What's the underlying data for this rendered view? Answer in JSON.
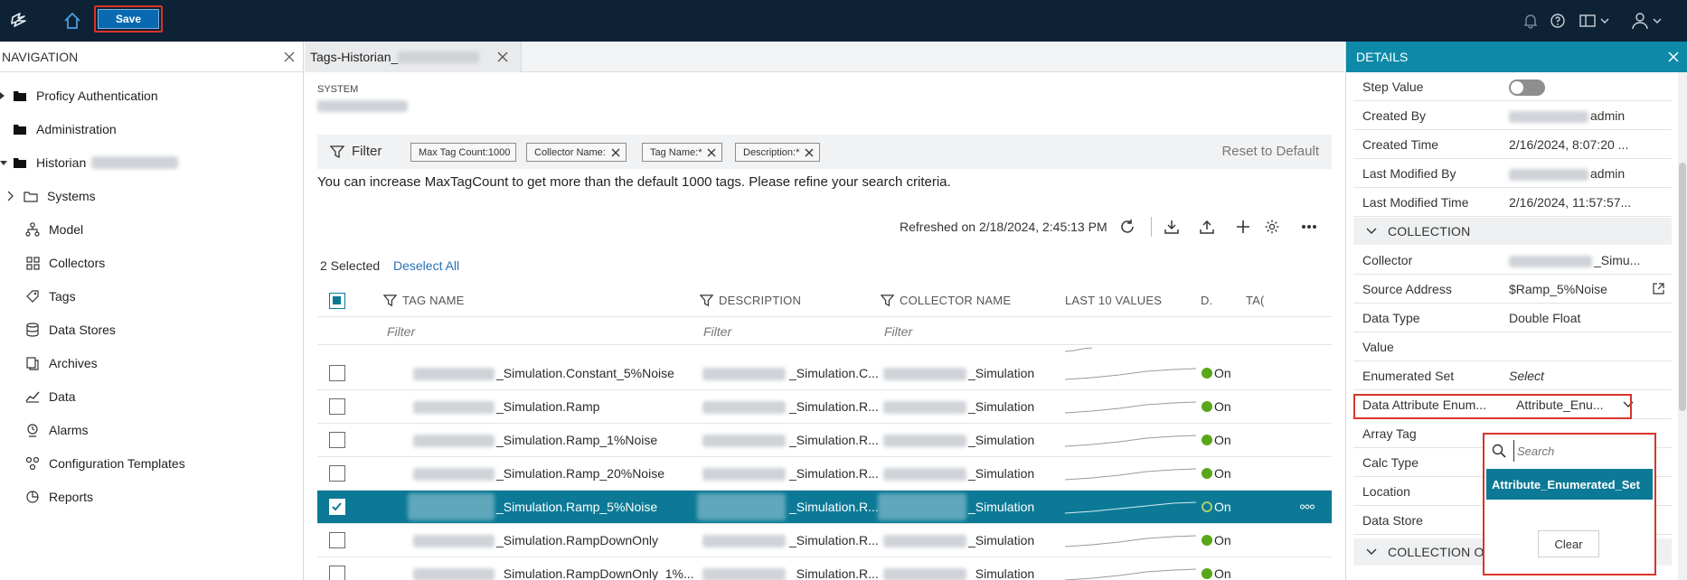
{
  "topbar": {
    "save_label": "Save"
  },
  "nav": {
    "title": "NAVIGATION",
    "items": [
      {
        "label": "Proficy Authentication",
        "icon": "folder-icon"
      },
      {
        "label": "Administration",
        "icon": "folder-icon"
      },
      {
        "label": "Historian",
        "icon": "folder-icon"
      },
      {
        "label": "Systems",
        "icon": "folder-outline-icon"
      },
      {
        "label": "Model",
        "icon": "hierarchy-icon"
      },
      {
        "label": "Collectors",
        "icon": "grid-icon"
      },
      {
        "label": "Tags",
        "icon": "tag-icon"
      },
      {
        "label": "Data Stores",
        "icon": "database-icon"
      },
      {
        "label": "Archives",
        "icon": "archive-icon"
      },
      {
        "label": "Data",
        "icon": "trend-icon"
      },
      {
        "label": "Alarms",
        "icon": "alarm-icon"
      },
      {
        "label": "Configuration Templates",
        "icon": "template-icon"
      },
      {
        "label": "Reports",
        "icon": "report-icon"
      }
    ]
  },
  "tab": {
    "label": "Tags-Historian_"
  },
  "main": {
    "system_label": "SYSTEM",
    "filter_label": "Filter",
    "chips": [
      "Max Tag Count:1000",
      "Collector Name:",
      "Tag Name:*",
      "Description:*"
    ],
    "reset_label": "Reset to Default",
    "info": "You can increase MaxTagCount to get more than the default 1000 tags. Please refine your search criteria.",
    "refreshed": "Refreshed on 2/18/2024, 2:45:13 PM",
    "selected_count": "2 Selected",
    "deselect_label": "Deselect All",
    "columns": [
      "TAG NAME",
      "DESCRIPTION",
      "COLLECTOR NAME",
      "LAST 10 VALUES",
      "D.",
      "TA("
    ],
    "filter_placeholder": "Filter",
    "rows": [
      {
        "tag": "_Simulation.Constant_5%Noise",
        "desc": "_Simulation.C...",
        "collector": "_Simulation",
        "status": "On",
        "selected": false
      },
      {
        "tag": "_Simulation.Ramp",
        "desc": "_Simulation.R...",
        "collector": "_Simulation",
        "status": "On",
        "selected": false
      },
      {
        "tag": "_Simulation.Ramp_1%Noise",
        "desc": "_Simulation.R...",
        "collector": "_Simulation",
        "status": "On",
        "selected": false
      },
      {
        "tag": "_Simulation.Ramp_20%Noise",
        "desc": "_Simulation.R...",
        "collector": "_Simulation",
        "status": "On",
        "selected": false
      },
      {
        "tag": "_Simulation.Ramp_5%Noise",
        "desc": "_Simulation.R...",
        "collector": "_Simulation",
        "status": "On",
        "selected": true
      },
      {
        "tag": "_Simulation.RampDownOnly",
        "desc": "_Simulation.R...",
        "collector": "_Simulation",
        "status": "On",
        "selected": false
      },
      {
        "tag": "_Simulation.RampDownOnly_1%...",
        "desc": "_Simulation.R...",
        "collector": "_Simulation",
        "status": "On",
        "selected": false
      }
    ]
  },
  "details": {
    "title": "DETAILS",
    "rows": [
      {
        "k": "Step Value",
        "v": ""
      },
      {
        "k": "Created By",
        "v": "admin"
      },
      {
        "k": "Created Time",
        "v": "2/16/2024, 8:07:20 ..."
      },
      {
        "k": "Last Modified By",
        "v": "admin"
      },
      {
        "k": "Last Modified Time",
        "v": "2/16/2024, 11:57:57..."
      }
    ],
    "section_collection": "COLLECTION",
    "collection_rows": [
      {
        "k": "Collector",
        "v": "_Simu..."
      },
      {
        "k": "Source Address",
        "v": "$Ramp_5%Noise"
      },
      {
        "k": "Data Type",
        "v": "Double Float"
      },
      {
        "k": "Value",
        "v": ""
      },
      {
        "k": "Enumerated Set",
        "v": "Select"
      },
      {
        "k": "Data Attribute Enum...",
        "v": "Attribute_Enu..."
      },
      {
        "k": "Array Tag",
        "v": ""
      },
      {
        "k": "Calc Type",
        "v": ""
      },
      {
        "k": "Location",
        "v": ""
      },
      {
        "k": "Data Store",
        "v": ""
      }
    ],
    "section_collection_opt": "COLLECTION OPT",
    "dropdown": {
      "search_placeholder": "Search",
      "option": "Attribute_Enumerated_Set",
      "clear_label": "Clear"
    }
  },
  "colors": {
    "topbar": "#0e2235",
    "accent": "#0c7a96",
    "details_header": "#0e8aa8",
    "status_on": "#58a619",
    "highlight": "#d9342b"
  }
}
